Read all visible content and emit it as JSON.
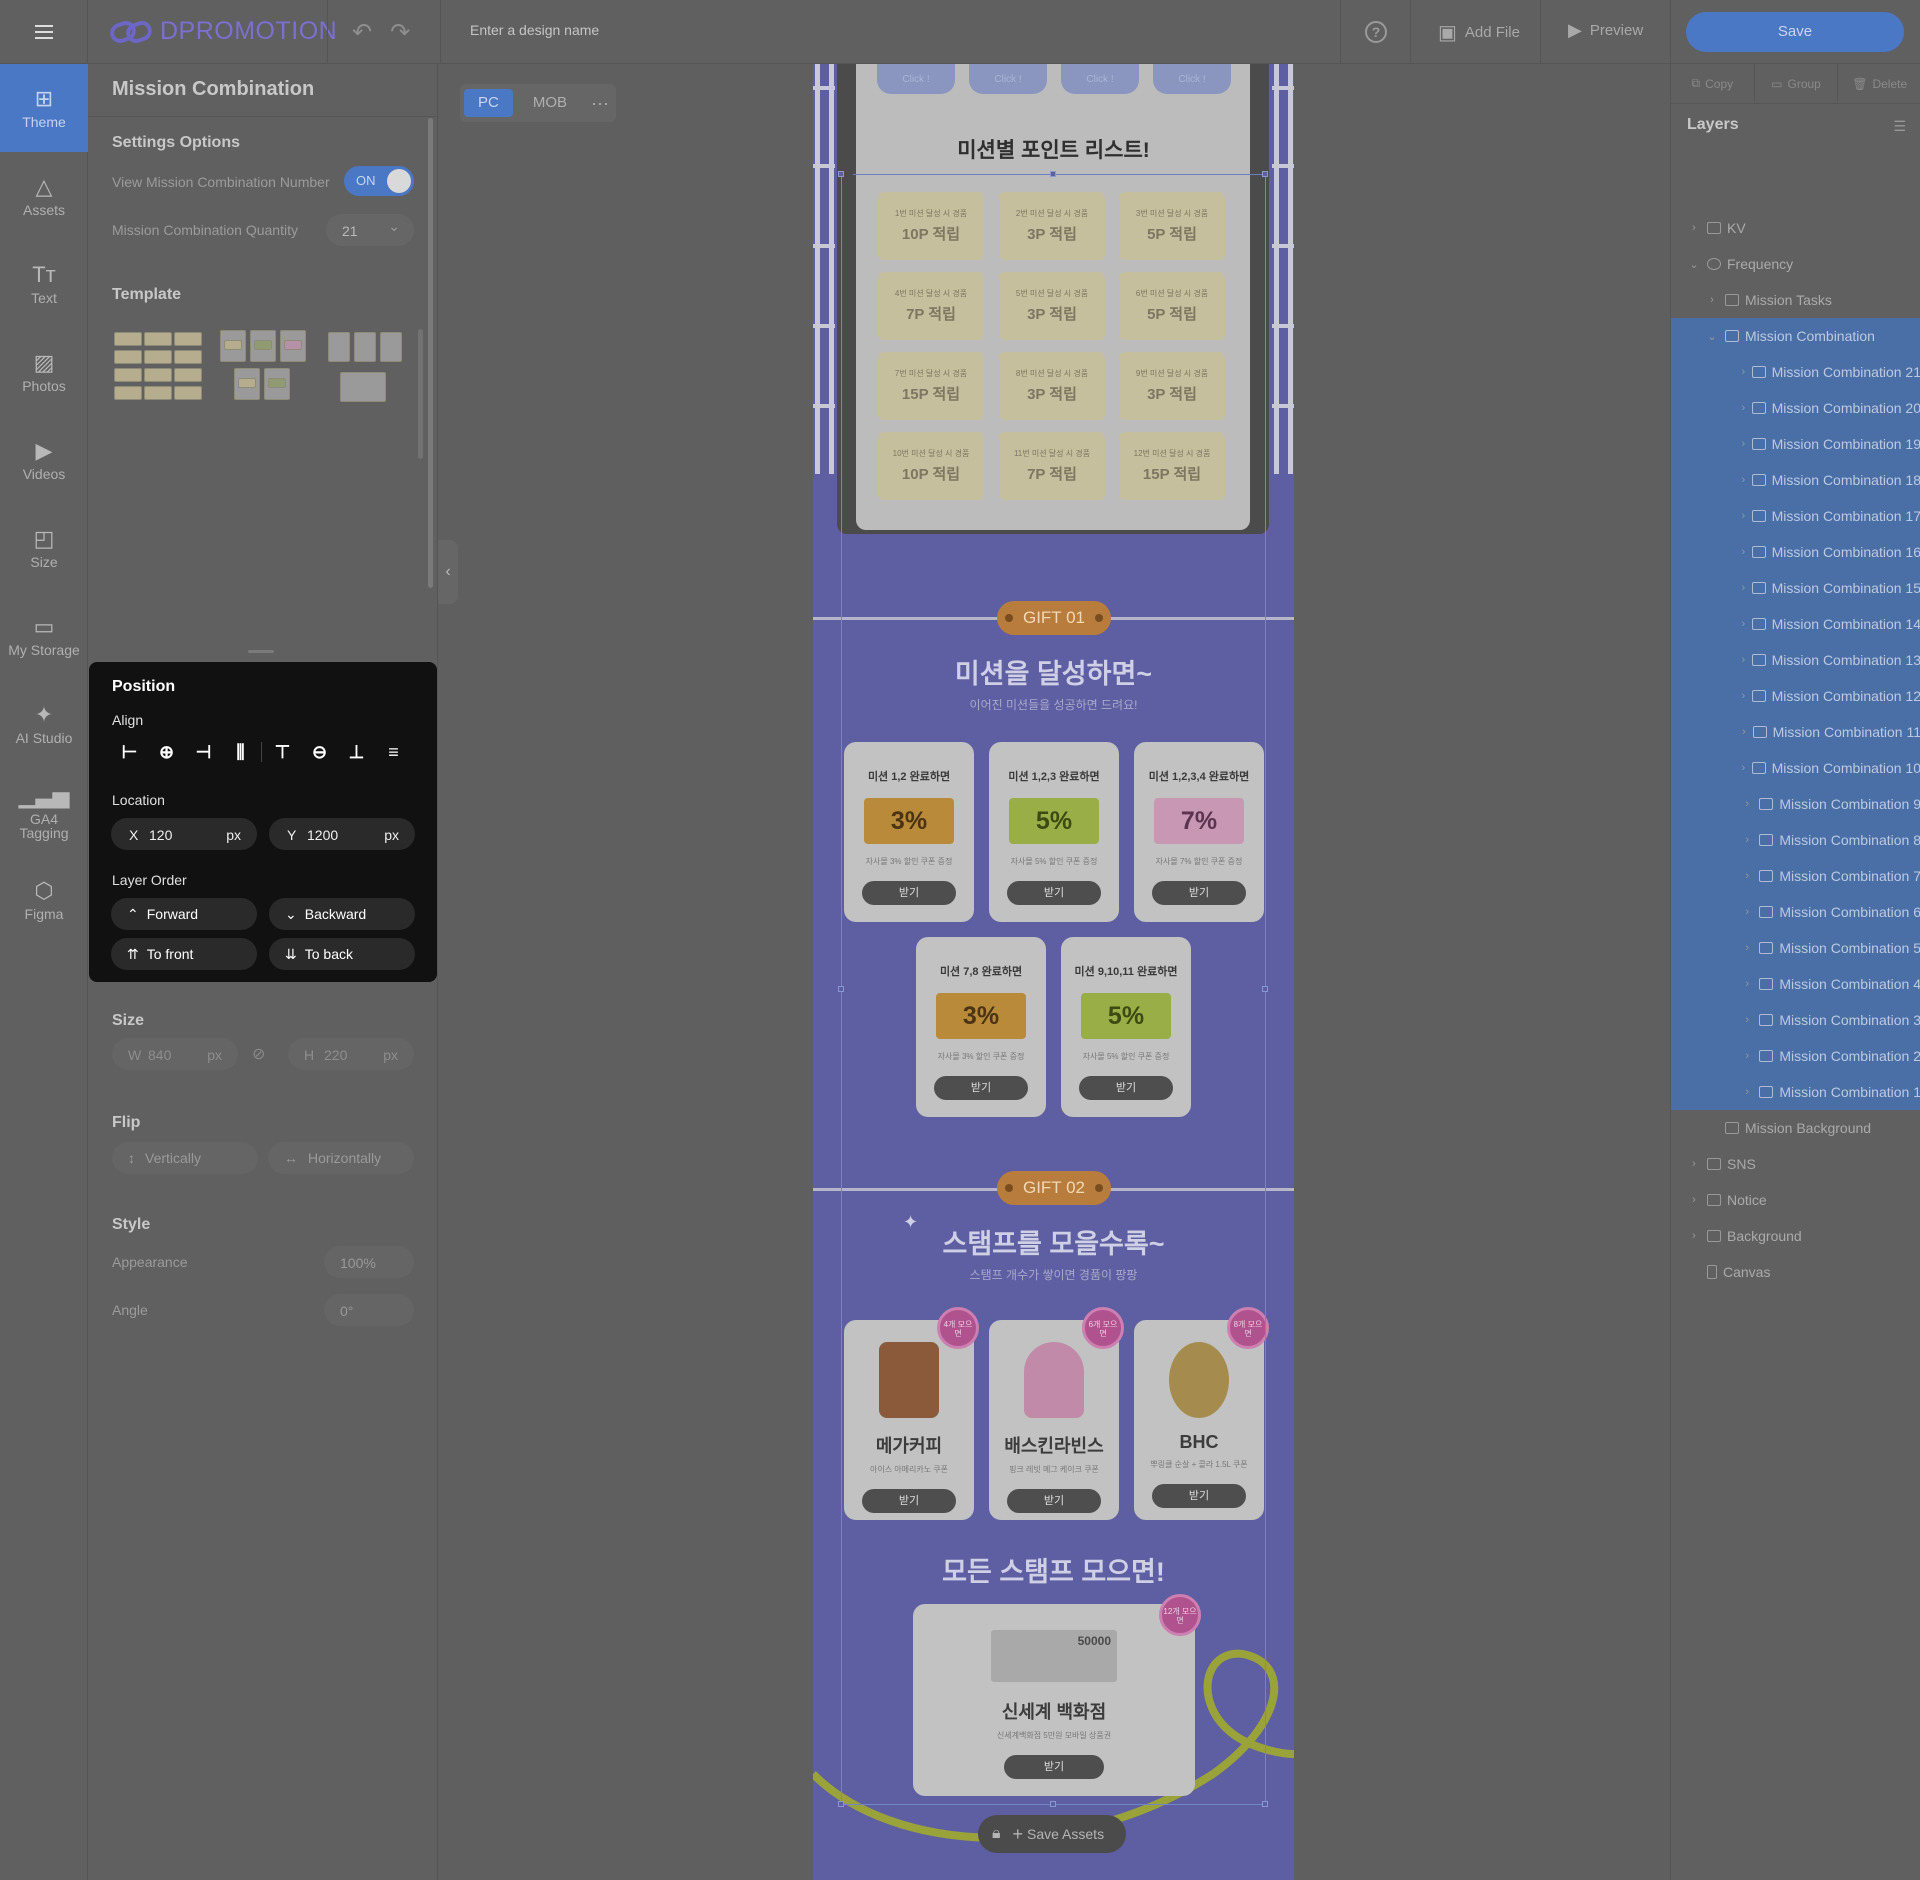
{
  "topbar": {
    "logo": "DPROMOTION",
    "design_name_placeholder": "Enter a design name",
    "help": "?",
    "add_file": "Add File",
    "preview": "Preview",
    "save": "Save"
  },
  "nav": [
    {
      "label": "Theme",
      "icon": "theme-icon"
    },
    {
      "label": "Assets",
      "icon": "assets-icon"
    },
    {
      "label": "Text",
      "icon": "text-icon"
    },
    {
      "label": "Photos",
      "icon": "photos-icon"
    },
    {
      "label": "Videos",
      "icon": "videos-icon"
    },
    {
      "label": "Size",
      "icon": "size-icon"
    },
    {
      "label": "My Storage",
      "icon": "folder-icon"
    },
    {
      "label": "AI Studio",
      "icon": "wand-icon"
    },
    {
      "label": "GA4 Tagging",
      "icon": "chart-icon"
    },
    {
      "label": "Figma",
      "icon": "figma-icon"
    }
  ],
  "panel": {
    "title": "Mission Combination",
    "settings_title": "Settings Options",
    "view_number_label": "View Mission Combination Number",
    "toggle_state": "ON",
    "quantity_label": "Mission Combination Quantity",
    "quantity_value": "21",
    "template_title": "Template",
    "size_title": "Size",
    "width_key": "W",
    "width_value": "840",
    "height_key": "H",
    "height_value": "220",
    "unit": "px",
    "flip_title": "Flip",
    "flip_vertical": "Vertically",
    "flip_horizontal": "Horizontally",
    "style_title": "Style",
    "appearance_label": "Appearance",
    "appearance_value": "100%",
    "angle_label": "Angle",
    "angle_value": "0°"
  },
  "position": {
    "title": "Position",
    "align_label": "Align",
    "location_label": "Location",
    "x_key": "X",
    "x_value": "120",
    "y_key": "Y",
    "y_value": "1200",
    "unit": "px",
    "layer_order_label": "Layer Order",
    "forward": "Forward",
    "backward": "Backward",
    "to_front": "To front",
    "to_back": "To back"
  },
  "canvas": {
    "device_pc": "PC",
    "device_mob": "MOB",
    "more": "···",
    "click_label": "Click !",
    "board_title": "미션별 포인트 리스트!",
    "tickets": [
      {
        "top": "1번 미션 달성 시 경품",
        "reward": "10P 적립"
      },
      {
        "top": "2번 미션 달성 시 경품",
        "reward": "3P 적립"
      },
      {
        "top": "3번 미션 달성 시 경품",
        "reward": "5P 적립"
      },
      {
        "top": "4번 미션 달성 시 경품",
        "reward": "7P 적립"
      },
      {
        "top": "5번 미션 달성 시 경품",
        "reward": "3P 적립"
      },
      {
        "top": "6번 미션 달성 시 경품",
        "reward": "5P 적립"
      },
      {
        "top": "7번 미션 달성 시 경품",
        "reward": "15P 적립"
      },
      {
        "top": "8번 미션 달성 시 경품",
        "reward": "3P 적립"
      },
      {
        "top": "9번 미션 달성 시 경품",
        "reward": "3P 적립"
      },
      {
        "top": "10번 미션 달성 시 경품",
        "reward": "10P 적립"
      },
      {
        "top": "11번 미션 달성 시 경품",
        "reward": "7P 적립"
      },
      {
        "top": "12번 미션 달성 시 경품",
        "reward": "15P 적립"
      }
    ],
    "gift1": "GIFT 01",
    "gift1_title": "미션을 달성하면~",
    "gift1_sub": "이어진 미션들을 성공하면 드려요!",
    "coupons": [
      {
        "title": "미션 1,2 완료하면",
        "pct": "3%",
        "desc": "자사몰 3% 할인 쿠폰 증정",
        "btn": "받기"
      },
      {
        "title": "미션 1,2,3 완료하면",
        "pct": "5%",
        "desc": "자사몰 5% 할인 쿠폰 증정",
        "btn": "받기"
      },
      {
        "title": "미션 1,2,3,4 완료하면",
        "pct": "7%",
        "desc": "자사몰 7% 할인 쿠폰 증정",
        "btn": "받기"
      },
      {
        "title": "미션 7,8 완료하면",
        "pct": "3%",
        "desc": "자사몰 3% 할인 쿠폰 증정",
        "btn": "받기"
      },
      {
        "title": "미션 9,10,11 완료하면",
        "pct": "5%",
        "desc": "자사몰 5% 할인 쿠폰 증정",
        "btn": "받기"
      }
    ],
    "gift2": "GIFT 02",
    "gift2_title": "스탬프를 모을수록~",
    "gift2_sub": "스탬프 개수가 쌓이면 경품이 팡팡",
    "stamps": [
      {
        "badge": "4개 모으면",
        "name": "메가커피",
        "desc": "아이스 아메리카노 쿠폰",
        "btn": "받기"
      },
      {
        "badge": "6개 모으면",
        "name": "배스킨라빈스",
        "desc": "핑크 레빗 메그 케이크 쿠폰",
        "btn": "받기"
      },
      {
        "badge": "8개 모으면",
        "name": "BHC",
        "desc": "뿌링클 순살 + 콜라 1.5L 쿠폰",
        "btn": "받기"
      }
    ],
    "all_title": "모든 스탬프 모으면!",
    "big_badge": "12개 모으면",
    "voucher_amount": "50000",
    "big_name": "신세계 백화점",
    "big_desc": "신세계백화점 5만원 모바일 상품권",
    "big_btn": "받기",
    "save_assets": "Save Assets"
  },
  "layers": {
    "actions": [
      "Copy",
      "Group",
      "Delete"
    ],
    "title": "Layers",
    "items": [
      {
        "label": "KV",
        "depth": 0,
        "kind": "folder",
        "chevron": "›"
      },
      {
        "label": "Frequency",
        "depth": 0,
        "kind": "globe",
        "chevron": "⌄"
      },
      {
        "label": "Mission Tasks",
        "depth": 1,
        "kind": "item",
        "chevron": "›"
      },
      {
        "label": "Mission Combination",
        "depth": 1,
        "kind": "item",
        "chevron": "⌄",
        "selected": true
      },
      {
        "label": "Mission Combination 21",
        "depth": 2,
        "kind": "item",
        "chevron": "›",
        "selected": true
      },
      {
        "label": "Mission Combination 20",
        "depth": 2,
        "kind": "item",
        "chevron": "›",
        "selected": true
      },
      {
        "label": "Mission Combination 19",
        "depth": 2,
        "kind": "item",
        "chevron": "›",
        "selected": true
      },
      {
        "label": "Mission Combination 18",
        "depth": 2,
        "kind": "item",
        "chevron": "›",
        "selected": true
      },
      {
        "label": "Mission Combination 17",
        "depth": 2,
        "kind": "item",
        "chevron": "›",
        "selected": true
      },
      {
        "label": "Mission Combination 16",
        "depth": 2,
        "kind": "item",
        "chevron": "›",
        "selected": true
      },
      {
        "label": "Mission Combination 15",
        "depth": 2,
        "kind": "item",
        "chevron": "›",
        "selected": true
      },
      {
        "label": "Mission Combination 14",
        "depth": 2,
        "kind": "item",
        "chevron": "›",
        "selected": true
      },
      {
        "label": "Mission Combination 13",
        "depth": 2,
        "kind": "item",
        "chevron": "›",
        "selected": true
      },
      {
        "label": "Mission Combination 12",
        "depth": 2,
        "kind": "item",
        "chevron": "›",
        "selected": true
      },
      {
        "label": "Mission Combination 11",
        "depth": 2,
        "kind": "item",
        "chevron": "›",
        "selected": true
      },
      {
        "label": "Mission Combination 10",
        "depth": 2,
        "kind": "item",
        "chevron": "›",
        "selected": true
      },
      {
        "label": "Mission Combination 9",
        "depth": 2,
        "kind": "item",
        "chevron": "›",
        "selected": true
      },
      {
        "label": "Mission Combination 8",
        "depth": 2,
        "kind": "item",
        "chevron": "›",
        "selected": true
      },
      {
        "label": "Mission Combination 7",
        "depth": 2,
        "kind": "item",
        "chevron": "›",
        "selected": true
      },
      {
        "label": "Mission Combination 6",
        "depth": 2,
        "kind": "item",
        "chevron": "›",
        "selected": true
      },
      {
        "label": "Mission Combination 5",
        "depth": 2,
        "kind": "item",
        "chevron": "›",
        "selected": true
      },
      {
        "label": "Mission Combination 4",
        "depth": 2,
        "kind": "item",
        "chevron": "›",
        "selected": true
      },
      {
        "label": "Mission Combination 3",
        "depth": 2,
        "kind": "item",
        "chevron": "›",
        "selected": true
      },
      {
        "label": "Mission Combination 2",
        "depth": 2,
        "kind": "item",
        "chevron": "›",
        "selected": true
      },
      {
        "label": "Mission Combination 1",
        "depth": 2,
        "kind": "item",
        "chevron": "›",
        "selected": true
      },
      {
        "label": "Mission Background",
        "depth": 1,
        "kind": "frame",
        "chevron": ""
      },
      {
        "label": "SNS",
        "depth": 0,
        "kind": "folder",
        "chevron": "›"
      },
      {
        "label": "Notice",
        "depth": 0,
        "kind": "folder",
        "chevron": "›"
      },
      {
        "label": "Background",
        "depth": 0,
        "kind": "folder",
        "chevron": "›"
      },
      {
        "label": "Canvas",
        "depth": 0,
        "kind": "page",
        "chevron": ""
      }
    ]
  },
  "colors": {
    "accent": "#4a78c4",
    "design_bg": "#5e5ea2",
    "popover": "#111111"
  }
}
